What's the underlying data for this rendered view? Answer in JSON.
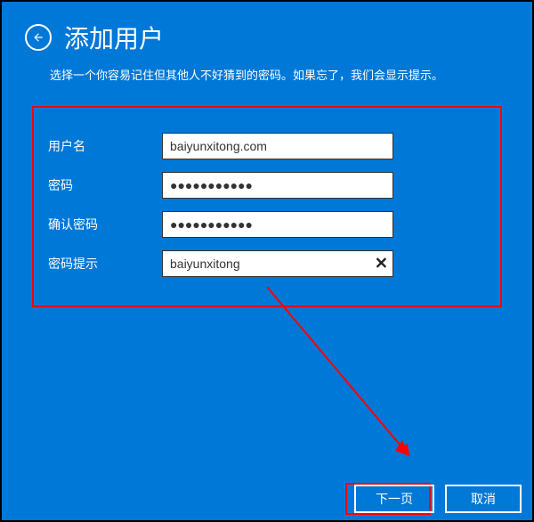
{
  "header": {
    "title": "添加用户",
    "subtitle": "选择一个你容易记住但其他人不好猜到的密码。如果忘了，我们会显示提示。"
  },
  "labels": {
    "username": "用户名",
    "password": "密码",
    "confirm": "确认密码",
    "hint": "密码提示"
  },
  "values": {
    "username": "baiyunxitong.com",
    "password": "●●●●●●●●●●●",
    "confirm": "●●●●●●●●●●●",
    "hint": "baiyunxitong"
  },
  "buttons": {
    "next": "下一页",
    "cancel": "取消"
  }
}
